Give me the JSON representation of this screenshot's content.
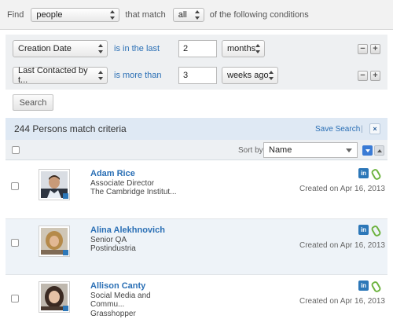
{
  "find_bar": {
    "find_label": "Find",
    "entity_value": "people",
    "that_match_label": "that match",
    "match_value": "all",
    "conditions_label": "of the following conditions"
  },
  "conditions": [
    {
      "field": "Creation Date",
      "operator": "is in the last",
      "value": "2",
      "unit": "months"
    },
    {
      "field": "Last Contacted by t...",
      "operator": "is more than",
      "value": "3",
      "unit": "weeks ago"
    }
  ],
  "controls": {
    "minus": "−",
    "plus": "+"
  },
  "search_button": "Search",
  "results": {
    "count_text": "244 Persons match criteria",
    "save_search": "Save Search",
    "separator": "|",
    "close": "×"
  },
  "sort": {
    "sort_by_label": "Sort by",
    "selected": "Name"
  },
  "people": [
    {
      "name": "Adam Rice",
      "title": "Associate Director",
      "company": "The Cambridge Institut...",
      "created": "Created on Apr 16, 2013"
    },
    {
      "name": "Alina Alekhnovich",
      "title": "Senior QA",
      "company": "Postindustria",
      "created": "Created on Apr 16, 2013"
    },
    {
      "name": "Allison Canty",
      "title": "Social Media and Commu...",
      "company": "Grasshopper",
      "created": "Created on Apr 16, 2013"
    }
  ],
  "icons": {
    "linkedin": "in"
  },
  "colors": {
    "link": "#2a6fb5",
    "linkedin": "#2c77b8",
    "attachment": "#6db33f"
  }
}
